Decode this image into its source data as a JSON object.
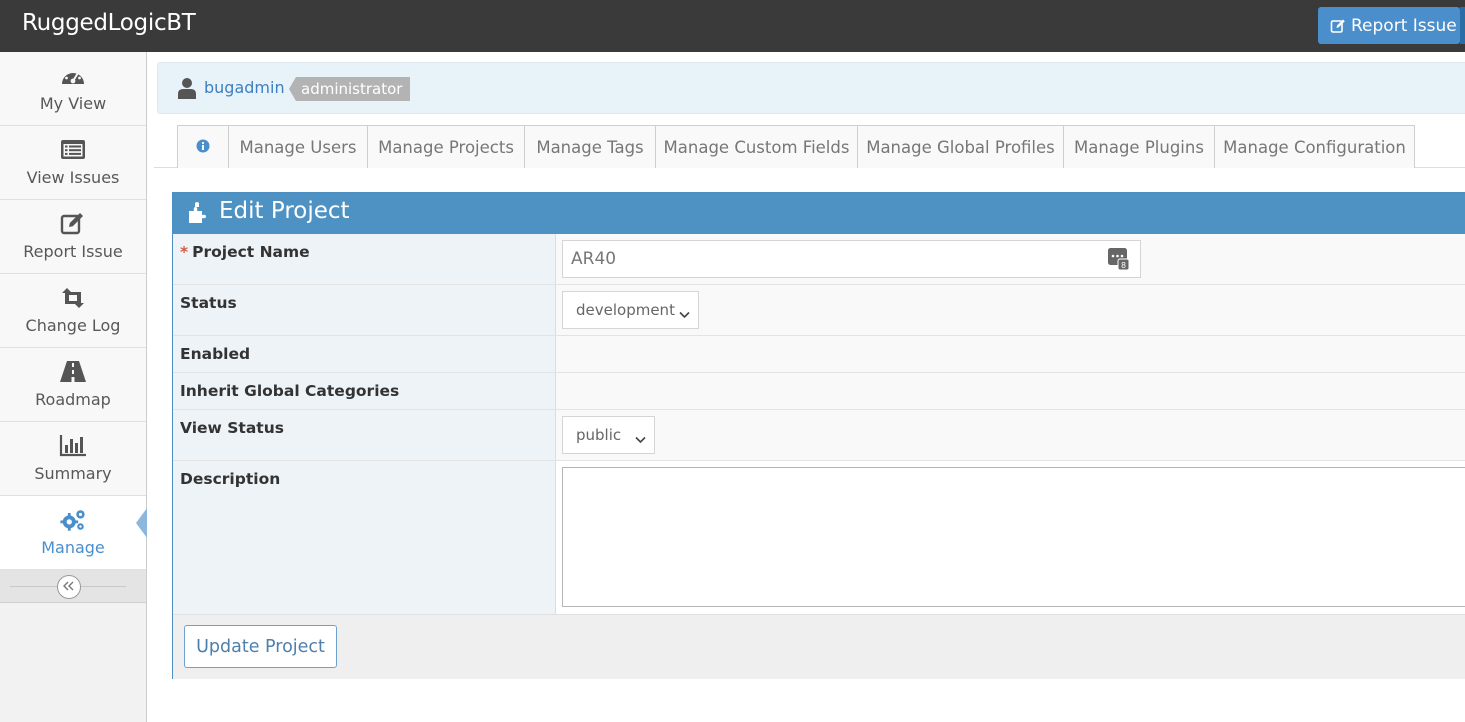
{
  "app": {
    "title": "RuggedLogicBT"
  },
  "header": {
    "report_issue_label": "Report Issue"
  },
  "sidebar": {
    "items": [
      {
        "label": "My View",
        "icon": "dashboard-icon"
      },
      {
        "label": "View Issues",
        "icon": "list-icon"
      },
      {
        "label": "Report Issue",
        "icon": "edit-icon"
      },
      {
        "label": "Change Log",
        "icon": "retweet-icon"
      },
      {
        "label": "Roadmap",
        "icon": "road-icon"
      },
      {
        "label": "Summary",
        "icon": "bar-chart-icon"
      },
      {
        "label": "Manage",
        "icon": "gears-icon",
        "active": true
      }
    ],
    "collapse_icon": "double-chevron-left-icon"
  },
  "user": {
    "name": "bugadmin",
    "role": "administrator"
  },
  "tabs": [
    {
      "label": "",
      "icon": "info-icon"
    },
    {
      "label": "Manage Users"
    },
    {
      "label": "Manage Projects"
    },
    {
      "label": "Manage Tags"
    },
    {
      "label": "Manage Custom Fields"
    },
    {
      "label": "Manage Global Profiles"
    },
    {
      "label": "Manage Plugins"
    },
    {
      "label": "Manage Configuration"
    }
  ],
  "form": {
    "title": "Edit Project",
    "title_icon": "puzzle-piece-icon",
    "required_mark": "*",
    "fields": {
      "project_name": {
        "label": "Project Name",
        "value": "AR40"
      },
      "status": {
        "label": "Status",
        "value": "development"
      },
      "enabled": {
        "label": "Enabled"
      },
      "inherit": {
        "label": "Inherit Global Categories"
      },
      "view_status": {
        "label": "View Status",
        "value": "public"
      },
      "description": {
        "label": "Description",
        "value": ""
      }
    },
    "submit_label": "Update Project"
  },
  "colors": {
    "navbar": "#3a3a3a",
    "accent": "#4a8fcb",
    "widget_header": "#4e91c3",
    "required": "#d15b47"
  }
}
